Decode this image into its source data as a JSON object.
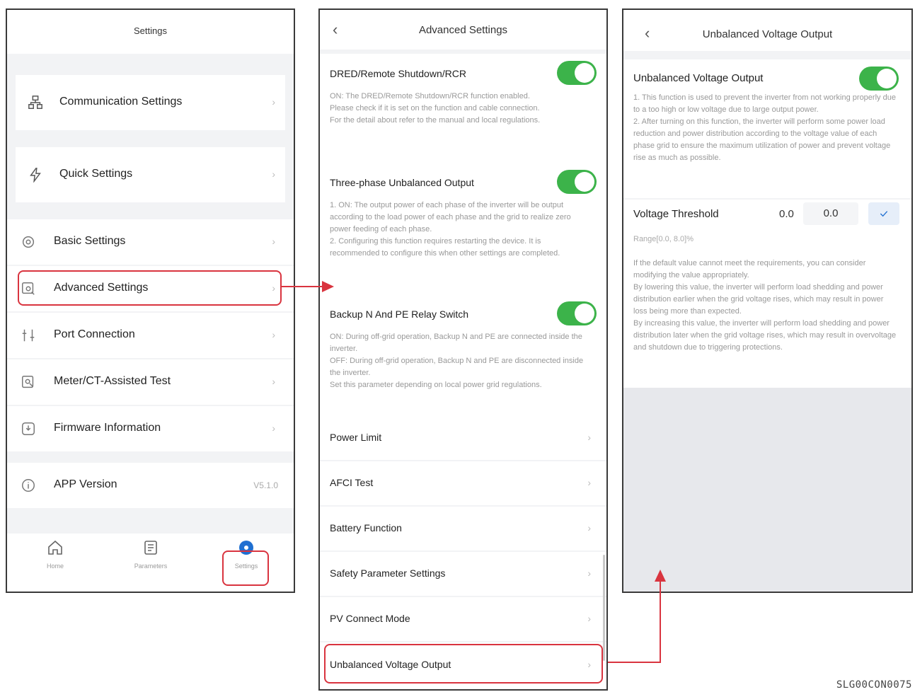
{
  "settings_screen": {
    "title": "Settings",
    "items": [
      {
        "label": "Communication Settings",
        "icon": "network-icon"
      },
      {
        "label": "Quick Settings",
        "icon": "flash-icon"
      },
      {
        "label": "Basic Settings",
        "icon": "gear-icon"
      },
      {
        "label": "Advanced Settings",
        "icon": "advanced-icon"
      },
      {
        "label": "Port Connection",
        "icon": "port-icon"
      },
      {
        "label": "Meter/CT-Assisted Test",
        "icon": "meter-test-icon"
      },
      {
        "label": "Firmware Information",
        "icon": "firmware-icon"
      },
      {
        "label": "APP Version",
        "icon": "info-icon",
        "value": "V5.1.0"
      }
    ],
    "tabs": [
      {
        "label": "Home",
        "icon": "home-icon"
      },
      {
        "label": "Parameters",
        "icon": "parameters-icon"
      },
      {
        "label": "Settings",
        "icon": "settings-tab-icon"
      }
    ]
  },
  "advanced_screen": {
    "title": "Advanced Settings",
    "toggles": [
      {
        "label": "DRED/Remote Shutdown/RCR",
        "on": true,
        "desc": [
          "ON: The DRED/Remote Shutdown/RCR function enabled.",
          "Please check if it is set on the function and cable connection.",
          "For the detail about refer to the manual and local regulations."
        ]
      },
      {
        "label": "Three-phase Unbalanced Output",
        "on": true,
        "desc": [
          "1. ON: The output power of each phase of the inverter will be output according to the load power of each phase and the grid to realize zero power feeding of each phase.",
          "2. Configuring this function requires restarting the device. It is recommended to configure this when other settings are completed."
        ]
      },
      {
        "label": "Backup N And PE Relay Switch",
        "on": true,
        "desc": [
          "ON: During off-grid operation, Backup N and PE are connected inside the inverter.",
          "OFF: During off-grid operation, Backup N and PE are disconnected inside the inverter.",
          "Set this parameter depending on local power grid regulations."
        ]
      }
    ],
    "items": [
      {
        "label": "Power Limit"
      },
      {
        "label": "AFCI Test"
      },
      {
        "label": "Battery Function"
      },
      {
        "label": "Safety Parameter Settings"
      },
      {
        "label": "PV Connect Mode"
      },
      {
        "label": "Unbalanced Voltage Output"
      }
    ]
  },
  "unbalanced_screen": {
    "title": "Unbalanced Voltage Output",
    "toggle_label": "Unbalanced Voltage Output",
    "toggle_on": true,
    "toggle_desc": [
      "1. This function is used to prevent the inverter from not working properly due to a too high or low voltage due to large output power.",
      "2. After turning on this function, the inverter will perform some power load reduction and power distribution according to the voltage value of each phase grid to ensure the maximum utilization of power and prevent voltage rise as much as possible."
    ],
    "threshold_label": "Voltage Threshold",
    "threshold_value": "0.0",
    "threshold_input": "0.0",
    "range_text": "Range[0.0, 8.0]%",
    "range_desc": [
      "If the default value cannot meet the requirements, you can consider modifying the value appropriately.",
      "By lowering this value, the inverter will perform load shedding and power distribution earlier when the grid voltage rises, which may result in power loss being more than expected.",
      "By increasing this value, the inverter will perform load shedding and power distribution later when the grid voltage rises, which may result in overvoltage and shutdown due to triggering protections."
    ]
  },
  "figure_code": "SLG00CON0075",
  "colors": {
    "accent_green": "#3cb34a",
    "highlight_red": "#d9343f",
    "tab_blue": "#1f6fd1"
  }
}
